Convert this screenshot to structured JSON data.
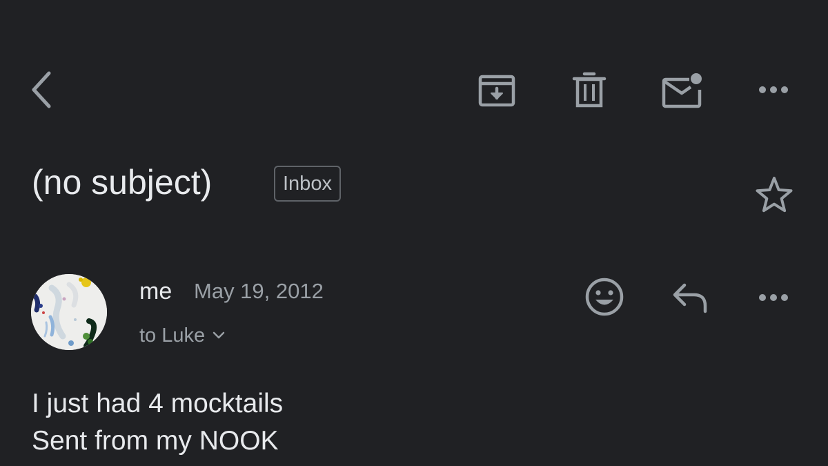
{
  "toolbar": {
    "back_icon": "chevron-left-icon",
    "archive_icon": "archive-icon",
    "delete_icon": "trash-icon",
    "mark_unread_icon": "mail-unread-icon",
    "more_icon": "more-horizontal-icon"
  },
  "email": {
    "subject": "(no subject)",
    "label": "Inbox",
    "starred": false,
    "sender": "me",
    "date": "May 19, 2012",
    "recipients": "to Luke",
    "body_lines": [
      "I just had 4 mocktails",
      "Sent from my NOOK"
    ]
  },
  "message_actions": {
    "react_icon": "emoji-smile-icon",
    "reply_icon": "reply-icon",
    "more_icon": "more-horizontal-icon"
  },
  "colors": {
    "background": "#202124",
    "primary_text": "#e8eaed",
    "secondary_text": "#9aa0a6",
    "icon": "#9aa0a6"
  }
}
